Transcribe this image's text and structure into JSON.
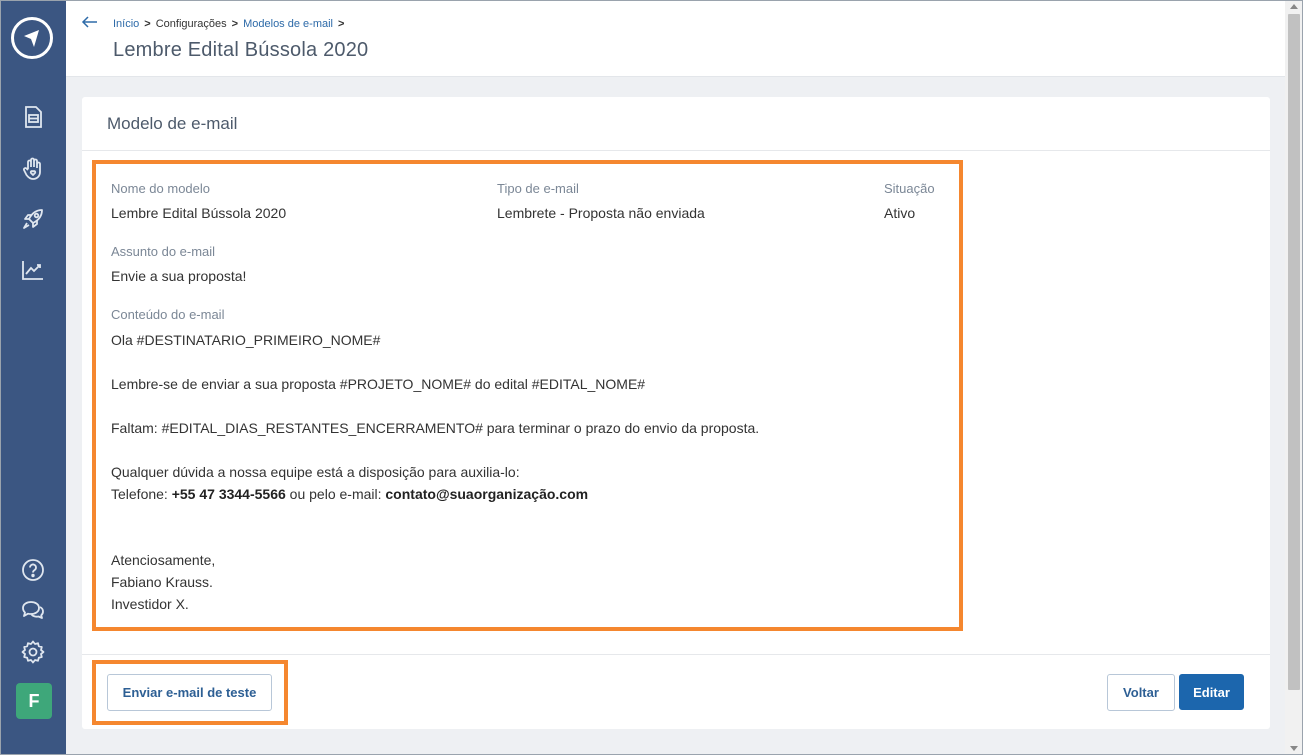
{
  "breadcrumb": {
    "home": "Início",
    "settings": "Configurações",
    "email_templates": "Modelos de e-mail",
    "separator": ">"
  },
  "page": {
    "title": "Lembre Edital Bússola 2020"
  },
  "card": {
    "title": "Modelo de e-mail"
  },
  "fields": {
    "name_label": "Nome do modelo",
    "name_value": "Lembre Edital Bússola 2020",
    "type_label": "Tipo de e-mail",
    "type_value": "Lembrete - Proposta não enviada",
    "status_label": "Situação",
    "status_value": "Ativo",
    "subject_label": "Assunto do e-mail",
    "subject_value": "Envie a sua proposta!",
    "content_label": "Conteúdo do e-mail"
  },
  "content": {
    "line1": "Ola #DESTINATARIO_PRIMEIRO_NOME#",
    "line2": "Lembre-se de enviar a sua proposta #PROJETO_NOME# do edital #EDITAL_NOME#",
    "line3": "Faltam: #EDITAL_DIAS_RESTANTES_ENCERRAMENTO# para terminar o prazo do envio da proposta.",
    "line4": "Qualquer dúvida a nossa equipe está a disposição para auxilia-lo:",
    "phone_prefix": "Telefone: ",
    "phone": "+55 47 3344-5566",
    "email_prefix": " ou pelo e-mail: ",
    "email": "contato@suaorganização.com",
    "sign1": "Atenciosamente,",
    "sign2": "Fabiano Krauss.",
    "sign3": "Investidor X."
  },
  "buttons": {
    "send_test": "Enviar e-mail de teste",
    "back": "Voltar",
    "edit": "Editar"
  },
  "user": {
    "initial": "F"
  },
  "sidebar": {
    "icons": [
      "logo-icon",
      "document-icon",
      "hand-heart-icon",
      "rocket-icon",
      "chart-icon",
      "help-icon",
      "chat-icon",
      "gear-icon"
    ]
  },
  "colors": {
    "sidebar": "#3b5682",
    "accent": "#1c66ad",
    "highlight": "#f5872f",
    "avatar": "#3ea77a"
  }
}
